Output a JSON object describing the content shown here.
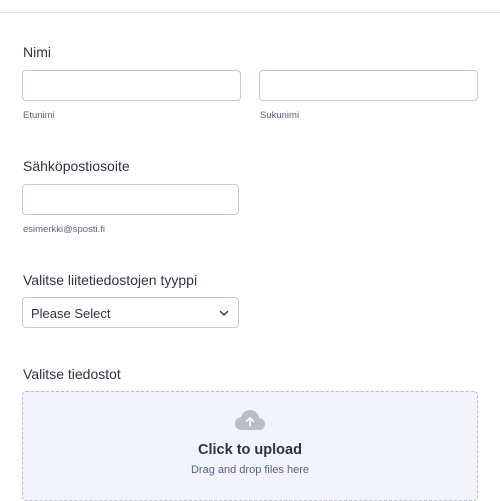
{
  "name_section": {
    "label": "Nimi",
    "first_name": {
      "value": "",
      "sublabel": "Etunimi"
    },
    "last_name": {
      "value": "",
      "sublabel": "Sukunimi"
    }
  },
  "email_section": {
    "label": "Sähköpostiosoite",
    "value": "",
    "sublabel": "esimerkki@sposti.fi"
  },
  "attachment_type": {
    "label": "Valitse liitetiedostojen tyyppi",
    "selected": "Please Select"
  },
  "files_section": {
    "label": "Valitse tiedostot",
    "upload_title": "Click to upload",
    "upload_subtitle": "Drag and drop files here"
  },
  "colors": {
    "border": "#c3cad8",
    "dropzone_bg": "#f3f3fe",
    "text": "#2c3345",
    "muted": "#57647e",
    "cloud_icon": "#b8bdc8"
  },
  "icons": {
    "select": "chevron-down-icon",
    "upload": "cloud-upload-icon"
  }
}
